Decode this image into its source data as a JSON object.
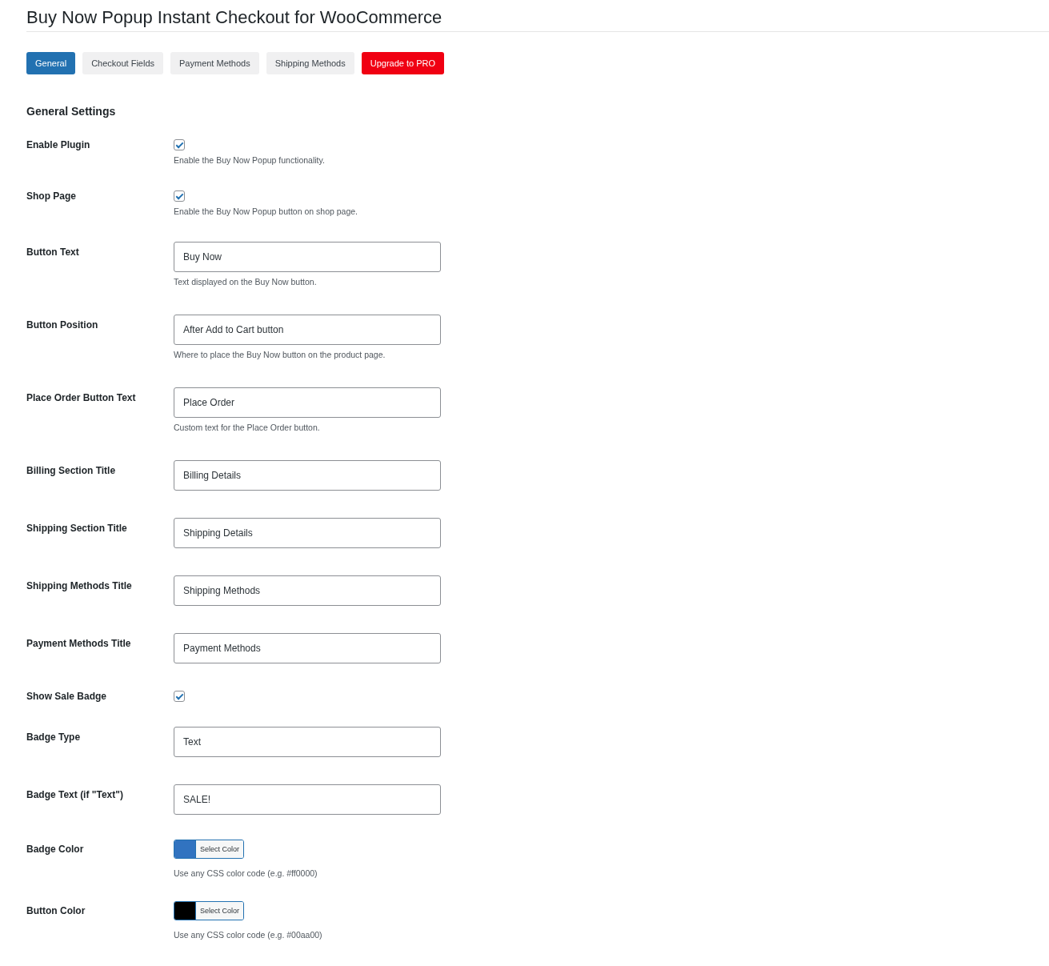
{
  "title": "Buy Now Popup Instant Checkout for WooCommerce",
  "tabs": [
    {
      "label": "General",
      "selected": true,
      "kind": "tab"
    },
    {
      "label": "Checkout Fields",
      "selected": false,
      "kind": "tab"
    },
    {
      "label": "Payment Methods",
      "selected": false,
      "kind": "tab"
    },
    {
      "label": "Shipping Methods",
      "selected": false,
      "kind": "tab"
    },
    {
      "label": "Upgrade to PRO",
      "selected": false,
      "kind": "upgrade"
    }
  ],
  "section_title": "General Settings",
  "settings": [
    {
      "kind": "checkbox",
      "label": "Enable Plugin",
      "checked": true,
      "description": "Enable the Buy Now Popup functionality."
    },
    {
      "kind": "checkbox",
      "label": "Shop Page",
      "checked": true,
      "description": "Enable the Buy Now Popup button on shop page."
    },
    {
      "kind": "text",
      "label": "Button Text",
      "value": "Buy Now",
      "description": "Text displayed on the Buy Now button."
    },
    {
      "kind": "text",
      "label": "Button Position",
      "value": "After Add to Cart button",
      "description": "Where to place the Buy Now button on the product page."
    },
    {
      "kind": "text",
      "label": "Place Order Button Text",
      "value": "Place Order",
      "description": "Custom text for the Place Order button."
    },
    {
      "kind": "text",
      "label": "Billing Section Title",
      "value": "Billing Details"
    },
    {
      "kind": "text",
      "label": "Shipping Section Title",
      "value": "Shipping Details"
    },
    {
      "kind": "text",
      "label": "Shipping Methods Title",
      "value": "Shipping Methods"
    },
    {
      "kind": "text",
      "label": "Payment Methods Title",
      "value": "Payment Methods"
    },
    {
      "kind": "checkbox",
      "label": "Show Sale Badge",
      "checked": true
    },
    {
      "kind": "text",
      "label": "Badge Type",
      "value": "Text"
    },
    {
      "kind": "text",
      "label": "Badge Text (if \"Text\")",
      "value": "SALE!"
    },
    {
      "kind": "color",
      "label": "Badge Color",
      "color": "#3173c0",
      "button": "Select Color",
      "description": "Use any CSS color code (e.g. #ff0000)"
    },
    {
      "kind": "color",
      "label": "Button Color",
      "color": "#000000",
      "button": "Select Color",
      "description": "Use any CSS color code (e.g. #00aa00)"
    }
  ]
}
